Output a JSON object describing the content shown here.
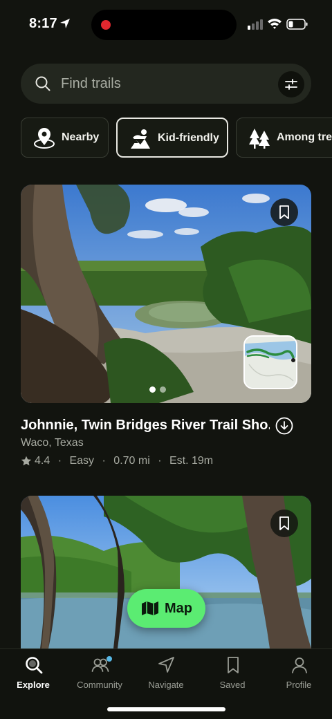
{
  "status_bar": {
    "time": "8:17"
  },
  "search": {
    "placeholder": "Find trails"
  },
  "chips": [
    {
      "label": "Nearby",
      "icon": "location-pin-icon"
    },
    {
      "label": "Kid-friendly",
      "icon": "kid-friendly-icon",
      "active": true
    },
    {
      "label": "Among trees",
      "icon": "trees-icon"
    }
  ],
  "trails": [
    {
      "title": "Johnnie, Twin Bridges River Trail Sho...",
      "location": "Waco, Texas",
      "rating": "4.4",
      "difficulty": "Easy",
      "distance": "0.70 mi",
      "estimate": "Est. 19m",
      "separator": "·"
    }
  ],
  "map_button": {
    "label": "Map",
    "icon": "map-icon"
  },
  "tab_bar": {
    "items": [
      {
        "label": "Explore",
        "icon": "explore-search-icon",
        "active": true
      },
      {
        "label": "Community",
        "icon": "community-icon"
      },
      {
        "label": "Navigate",
        "icon": "navigate-icon"
      },
      {
        "label": "Saved",
        "icon": "bookmark-icon"
      },
      {
        "label": "Profile",
        "icon": "profile-icon"
      }
    ]
  },
  "colors": {
    "background": "#12140f",
    "accent_green": "#5bec72",
    "search_bg": "#23271f",
    "notification_dot": "#57b8e6"
  }
}
